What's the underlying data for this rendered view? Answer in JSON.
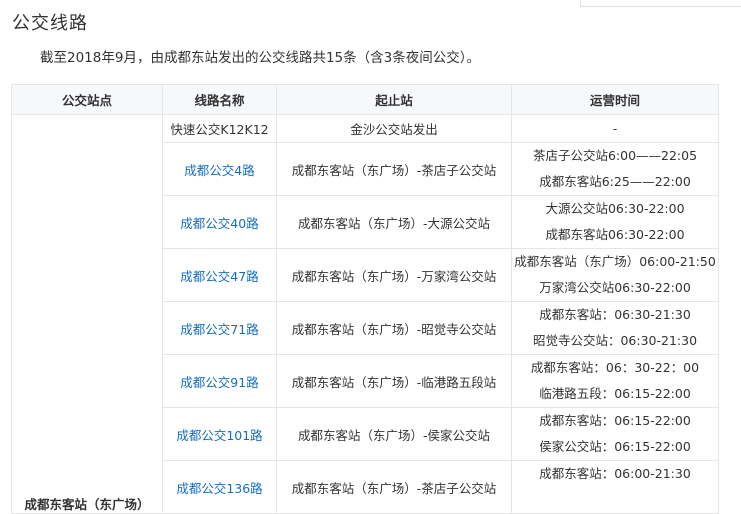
{
  "title": "公交线路",
  "intro": "截至2018年9月，由成都东站发出的公交线路共15条（含3条夜间公交）。",
  "table": {
    "headers": [
      "公交站点",
      "线路名称",
      "起止站",
      "运营时间"
    ],
    "station": "成都东客站（东广场）",
    "rows": [
      {
        "route": "快速公交K12K12",
        "stops": "金沙公交站发出",
        "times": [
          "-"
        ]
      },
      {
        "route": "成都公交4路",
        "stops": "成都东客站（东广场）-茶店子公交站",
        "times": [
          "茶店子公交站6:00——22:05",
          "成都东客站6:25——22:00"
        ]
      },
      {
        "route": "成都公交40路",
        "stops": "成都东客站（东广场）-大源公交站",
        "times": [
          "大源公交站06:30-22:00",
          "成都东客站06:30-22:00"
        ]
      },
      {
        "route": "成都公交47路",
        "stops": "成都东客站（东广场）-万家湾公交站",
        "times": [
          "成都东客站（东广场）06:00-21:50",
          "万家湾公交站06:30-22:00"
        ]
      },
      {
        "route": "成都公交71路",
        "stops": "成都东客站（东广场）-昭觉寺公交站",
        "times": [
          "成都东客站：06:30-21:30",
          "昭觉寺公交站：06:30-21:30"
        ]
      },
      {
        "route": "成都公交91路",
        "stops": "成都东客站（东广场）-临港路五段站",
        "times": [
          "成都东客站：06：30-22：00",
          "临港路五段：06:15-22:00"
        ]
      },
      {
        "route": "成都公交101路",
        "stops": "成都东客站（东广场）-侯家公交站",
        "times": [
          "成都东客站：06:15-22:00",
          "侯家公交站：06:15-22:00"
        ]
      },
      {
        "route": "成都公交136路",
        "stops": "成都东客站（东广场）-茶店子公交站",
        "times": [
          "成都东客站：06:00-21:30"
        ]
      }
    ]
  }
}
